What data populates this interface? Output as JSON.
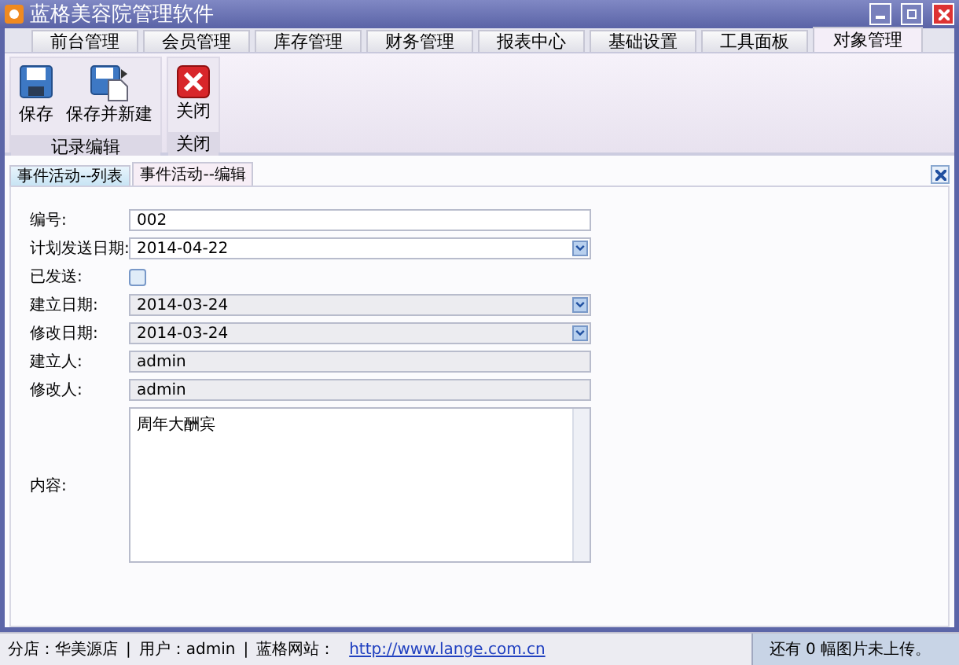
{
  "window": {
    "title": "蓝格美容院管理软件"
  },
  "main_tabs": [
    {
      "label": "前台管理",
      "selected": false
    },
    {
      "label": "会员管理",
      "selected": false
    },
    {
      "label": "库存管理",
      "selected": false
    },
    {
      "label": "财务管理",
      "selected": false
    },
    {
      "label": "报表中心",
      "selected": false
    },
    {
      "label": "基础设置",
      "selected": false
    },
    {
      "label": "工具面板",
      "selected": false
    },
    {
      "label": "对象管理",
      "selected": true
    }
  ],
  "ribbon": [
    {
      "label": "记录编辑",
      "buttons": [
        {
          "label": "保存",
          "kind": "save"
        },
        {
          "label": "保存并新建",
          "kind": "save-new"
        }
      ]
    },
    {
      "label": "关闭",
      "buttons": [
        {
          "label": "关闭",
          "kind": "close"
        }
      ]
    }
  ],
  "doc_tabs": [
    {
      "label": "事件活动--列表",
      "selected": false
    },
    {
      "label": "事件活动--编辑",
      "selected": true
    }
  ],
  "form": [
    {
      "label": "编号:",
      "kind": "text",
      "value": "002",
      "disabled": false
    },
    {
      "label": "计划发送日期:",
      "kind": "date",
      "value": "2014-04-22",
      "disabled": false
    },
    {
      "label": "已发送:",
      "kind": "checkbox",
      "checked": false
    },
    {
      "label": "建立日期:",
      "kind": "date",
      "value": "2014-03-24",
      "disabled": true
    },
    {
      "label": "修改日期:",
      "kind": "date",
      "value": "2014-03-24",
      "disabled": true
    },
    {
      "label": "建立人:",
      "kind": "text",
      "value": "admin",
      "disabled": true
    },
    {
      "label": "修改人:",
      "kind": "text",
      "value": "admin",
      "disabled": true
    },
    {
      "label": "内容:",
      "kind": "textarea",
      "value": "周年大酬宾",
      "disabled": false
    }
  ],
  "status_bar": {
    "items": [
      {
        "kind": "text",
        "text": "分店：华美源店"
      },
      {
        "kind": "separator",
        "text": "|"
      },
      {
        "kind": "text",
        "text": "用户：admin"
      },
      {
        "kind": "separator",
        "text": "|"
      },
      {
        "kind": "text",
        "text": "蓝格网站："
      },
      {
        "kind": "link",
        "text": "http://www.lange.com.cn"
      }
    ],
    "upload": "还有 0 幅图片未上传。"
  }
}
